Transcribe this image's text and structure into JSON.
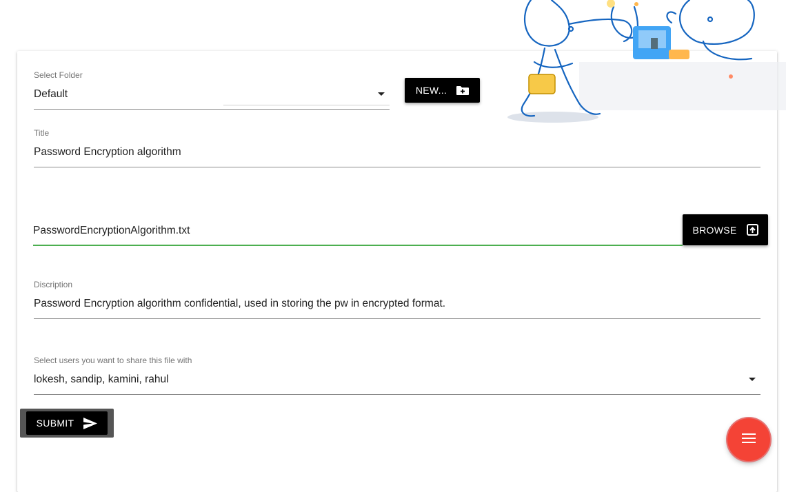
{
  "folder": {
    "label": "Select Folder",
    "value": "Default",
    "new_button_label": "NEW..."
  },
  "title_field": {
    "label": "Title",
    "value": "Password Encryption algorithm"
  },
  "file_field": {
    "value": "PasswordEncryptionAlgorithm.txt",
    "browse_label": "BROWSE"
  },
  "description_field": {
    "label": "Discription",
    "value": "Password Encryption algorithm confidential, used in storing the pw in encrypted format."
  },
  "share_field": {
    "label": "Select users you want to share this file with",
    "value": "lokesh, sandip, kamini, rahul"
  },
  "submit_label": "SUBMIT",
  "colors": {
    "accent_green": "#4caf50",
    "fab_red": "#f44336",
    "button_black": "#000000"
  },
  "icons": [
    "folder-plus-icon",
    "upload-icon",
    "send-icon",
    "menu-icon",
    "dropdown-caret-icon"
  ]
}
